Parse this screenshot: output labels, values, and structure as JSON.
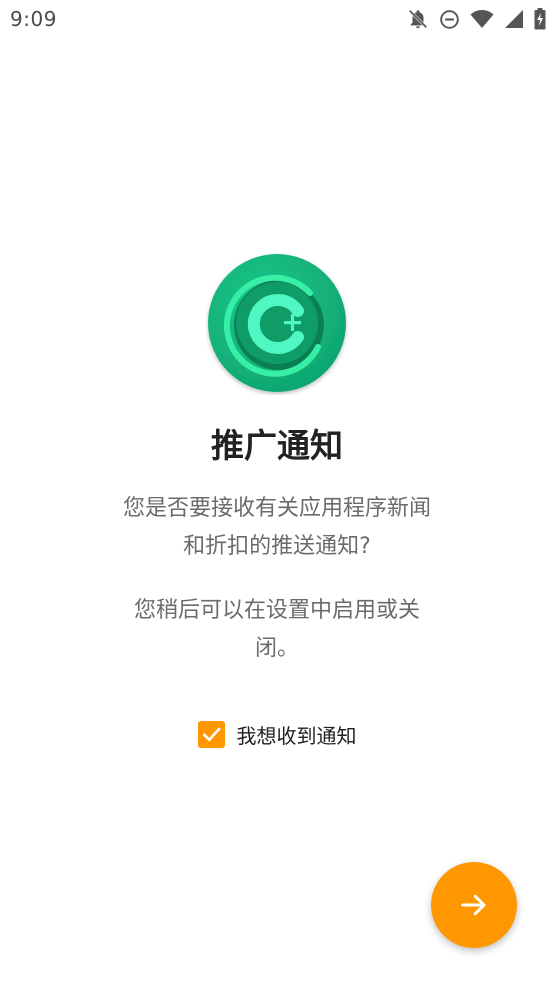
{
  "status_bar": {
    "time": "9:09",
    "icons": [
      "notifications-off-icon",
      "do-not-disturb-icon",
      "wifi-icon",
      "signal-icon",
      "battery-charging-icon"
    ]
  },
  "logo": {
    "icon": "app-logo-c-plus-icon",
    "colors": {
      "outer": "#13b07b",
      "inner": "#0e8f60",
      "accent": "#2ef0a0"
    }
  },
  "main": {
    "title": "推广通知",
    "question_line1": "您是否要接收有关应用程序新闻",
    "question_line2": "和折扣的推送通知?",
    "hint_line1": "您稍后可以在设置中启用或关",
    "hint_line2": "闭。"
  },
  "opt_in": {
    "label": "我想收到通知",
    "checked": true,
    "color": "#ff9800"
  },
  "fab": {
    "icon": "arrow-right-icon",
    "color": "#ff9800"
  }
}
